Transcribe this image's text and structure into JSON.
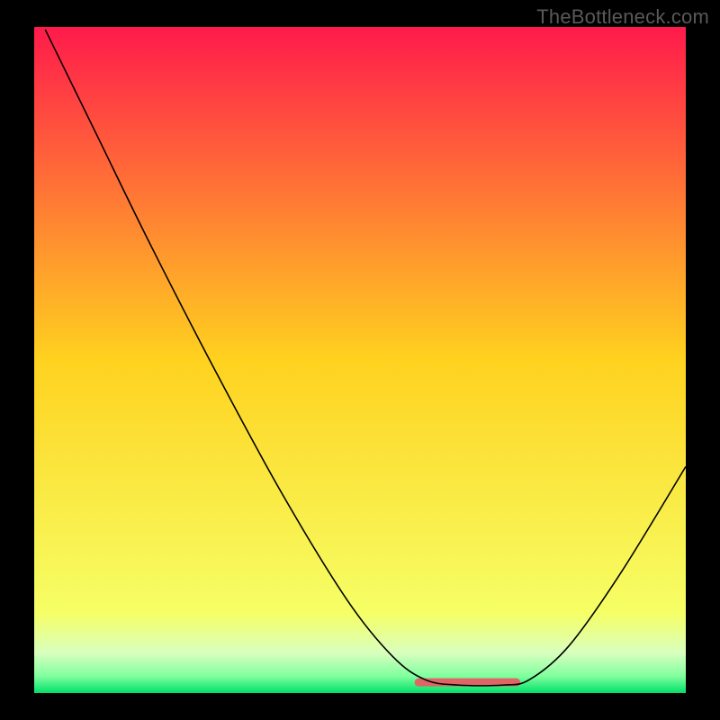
{
  "watermark": "TheBottleneck.com",
  "chart_data": {
    "type": "line",
    "title": "",
    "xlabel": "",
    "ylabel": "",
    "xlim": [
      0,
      100
    ],
    "ylim": [
      0,
      100
    ],
    "background_gradient": {
      "stops": [
        {
          "offset": 0.0,
          "color": "#ff1a4b"
        },
        {
          "offset": 0.5,
          "color": "#ffd21f"
        },
        {
          "offset": 0.88,
          "color": "#f6ff66"
        },
        {
          "offset": 0.94,
          "color": "#d8ffbe"
        },
        {
          "offset": 0.975,
          "color": "#7fff9e"
        },
        {
          "offset": 1.0,
          "color": "#00e06a"
        }
      ]
    },
    "series": [
      {
        "name": "bottleneck-curve",
        "color": "#000000",
        "width": 1.6,
        "points": [
          {
            "x": 1.7,
            "y": 99.6
          },
          {
            "x": 5.0,
            "y": 93.0
          },
          {
            "x": 10.0,
            "y": 83.0
          },
          {
            "x": 18.0,
            "y": 67.0
          },
          {
            "x": 28.0,
            "y": 48.0
          },
          {
            "x": 38.0,
            "y": 30.0
          },
          {
            "x": 48.0,
            "y": 14.0
          },
          {
            "x": 55.0,
            "y": 5.5
          },
          {
            "x": 60.0,
            "y": 2.0
          },
          {
            "x": 65.0,
            "y": 1.2
          },
          {
            "x": 72.0,
            "y": 1.2
          },
          {
            "x": 76.0,
            "y": 2.0
          },
          {
            "x": 82.0,
            "y": 7.0
          },
          {
            "x": 90.0,
            "y": 18.0
          },
          {
            "x": 100.0,
            "y": 34.0
          }
        ]
      }
    ],
    "flat_segment": {
      "color": "#e06666",
      "width": 9,
      "x1": 59.0,
      "x2": 74.0,
      "y": 1.6
    }
  }
}
